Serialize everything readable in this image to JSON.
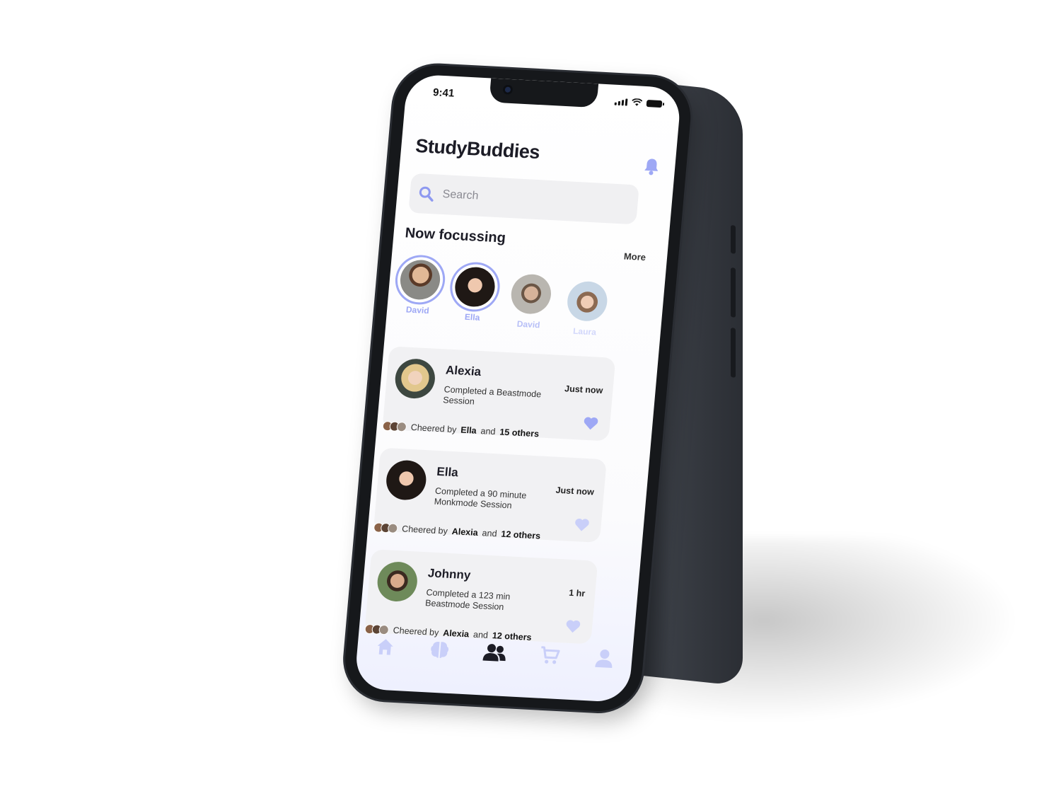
{
  "status_bar": {
    "time": "9:41"
  },
  "app": {
    "title": "StudyBuddies"
  },
  "search": {
    "placeholder": "Search"
  },
  "now_focussing": {
    "title": "Now focussing",
    "more_label": "More",
    "users": [
      {
        "name": "David",
        "active": true
      },
      {
        "name": "Ella",
        "active": true
      },
      {
        "name": "David",
        "active": false
      },
      {
        "name": "Laura",
        "active": false
      }
    ]
  },
  "feed": [
    {
      "name": "Alexia",
      "description": "Completed a  Beastmode Session",
      "time": "Just now",
      "liked": true,
      "cheer_prefix": "Cheered by",
      "cheer_name": "Ella",
      "cheer_and": "and",
      "cheer_others": "15 others"
    },
    {
      "name": "Ella",
      "description": "Completed a 90 minute Monkmode Session",
      "time": "Just now",
      "liked": false,
      "cheer_prefix": "Cheered by",
      "cheer_name": "Alexia",
      "cheer_and": "and",
      "cheer_others": "12 others"
    },
    {
      "name": "Johnny",
      "description": "Completed a 123 min Beastmode Session",
      "time": "1 hr",
      "liked": false,
      "cheer_prefix": "Cheered by",
      "cheer_name": "Alexia",
      "cheer_and": "and",
      "cheer_others": "12 others"
    }
  ],
  "tabbar": {
    "items": [
      "home-icon",
      "brain-icon",
      "friends-icon",
      "cart-icon",
      "profile-icon"
    ],
    "active": "friends-icon"
  },
  "colors": {
    "accent": "#9ea8f5",
    "accent_light": "#c9cff9",
    "text": "#1c1c26",
    "card": "#f1f1f3"
  }
}
